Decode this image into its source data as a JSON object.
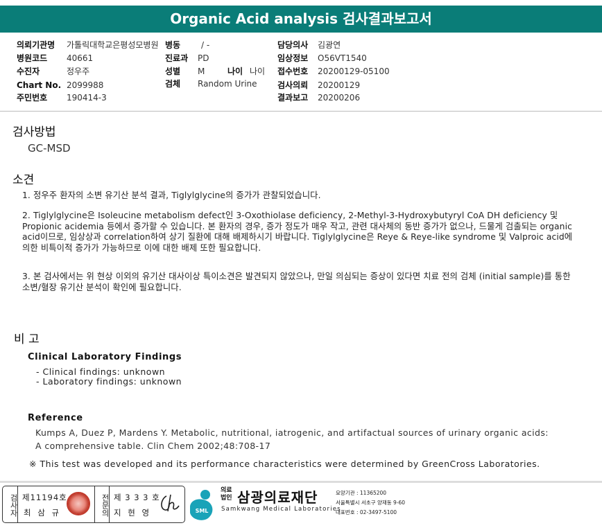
{
  "header": {
    "title": "Organic Acid analysis 검사결과보고서"
  },
  "info": {
    "col1": [
      {
        "label": "의뢰기관명",
        "value": "가톨릭대학교은평성모병원"
      },
      {
        "label": "병원코드",
        "value": "40661"
      },
      {
        "label": "수진자",
        "value": "정우주"
      },
      {
        "label": "Chart No.",
        "value": "2099988"
      },
      {
        "label": "주민번호",
        "value": "190414-3"
      }
    ],
    "col2": [
      {
        "label": "병동",
        "value": "/ -"
      },
      {
        "label": "진료과",
        "value": "PD"
      },
      {
        "label": "성별",
        "value": "M"
      },
      {
        "label": "검체",
        "value": "Random Urine"
      }
    ],
    "age": {
      "label": "나이",
      "value": "나이"
    },
    "col3": [
      {
        "label": "담당의사",
        "value": "김광연"
      },
      {
        "label": "임상정보",
        "value": "O56VT1540"
      },
      {
        "label": "접수번호",
        "value": "20200129-05100"
      },
      {
        "label": "검사의뢰",
        "value": "20200129"
      },
      {
        "label": "결과보고",
        "value": "20200206"
      }
    ]
  },
  "method": {
    "title": "검사방법",
    "value": "GC-MSD"
  },
  "findings": {
    "title": "소견",
    "items": [
      "1. 정우주 환자의 소변 유기산 분석 결과, Tiglylglycine의 증가가 관찰되었습니다.",
      "2. Tiglylglycine은 Isoleucine metabolism defect인 3-Oxothiolase deficiency, 2-Methyl-3-Hydroxybutyryl CoA DH deficiency 및 Propionic acidemia 등에서 증가할 수 있습니다. 본 환자의 경우, 증가 정도가 매우 작고, 관련 대사체의 동반 증가가 없으나, 드물게 검출되는 organic acid이므로, 임상상과 correlation하여 상기 질환에 대해 배제하시기 바랍니다. Tiglylglycine은 Reye & Reye-like syndrome 및 Valproic acid에 의한 비특이적 증가가 가능하므로 이에 대한 배제 또한 필요합니다.",
      "3. 본 검사에서는 위 현상 이외의 유기산 대사이상 특이소견은 발견되지 않았으나, 만일 의심되는 증상이 있다면 치료 전의 검체 (initial sample)를 통한 소변/혈장 유기산 분석이 확인에 필요합니다."
    ]
  },
  "remarks": {
    "title": "비 고",
    "clinical_title": "Clinical Laboratory Findings",
    "clinical_items": [
      "- Clinical findings: unknown",
      "- Laboratory findings: unknown"
    ],
    "reference_title": "Reference",
    "reference_lines": [
      "Kumps A, Duez P, Mardens Y. Metabolic, nutritional, iatrogenic, and artifactual sources of urinary organic acids:",
      "A comprehensive table. Clin Chem 2002;48:708-17"
    ],
    "note": "※ This test was developed and its performance characteristics were determined by GreenCross Laboratories."
  },
  "footer": {
    "inspector_label": "검사자",
    "inspector_license": "제11194호",
    "inspector_name": "최 삼 규",
    "reviewer_label": "전문의",
    "reviewer_license": "제 3 3 3 호",
    "reviewer_name": "지 현 영",
    "org_prefix_1": "의료",
    "org_prefix_2": "법인",
    "org_name": "삼광의료재단",
    "org_english": "Samkwang Medical Laboratories",
    "logo_text": "SML",
    "institution_no": "요양기관 : 11365200",
    "address": "서울특별시 서초구 양재동 9-60",
    "phone": "대표번호 : 02-3497-5100"
  },
  "colors": {
    "title_bar": "#0a7d78",
    "seal": "#c0392b",
    "logo": "#1aa3b8"
  }
}
